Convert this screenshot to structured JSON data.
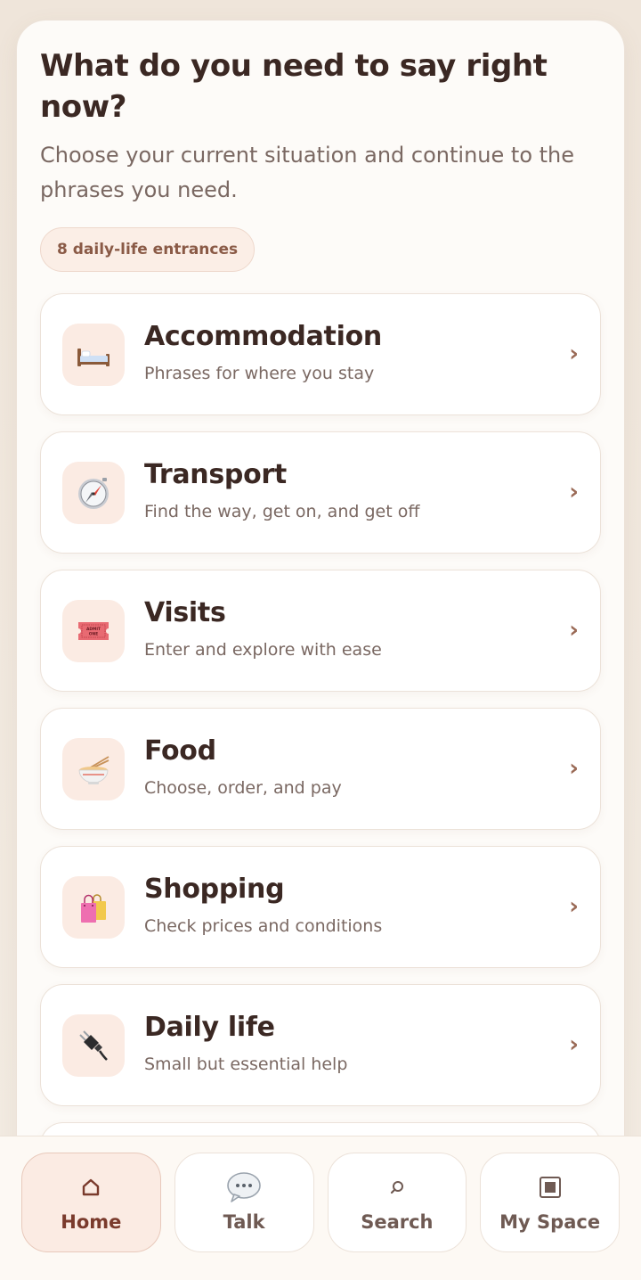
{
  "header": {
    "title": "What do you need to say right now?",
    "subtitle": "Choose your current situation and continue to the phrases you need.",
    "entrances_badge": "8 daily-life entrances"
  },
  "categories": [
    {
      "title": "Accommodation",
      "subtitle": "Phrases for where you stay",
      "icon": "bed-icon"
    },
    {
      "title": "Transport",
      "subtitle": "Find the way, get on, and get off",
      "icon": "compass-icon"
    },
    {
      "title": "Visits",
      "subtitle": "Enter and explore with ease",
      "icon": "ticket-icon",
      "icon_text": "ADMIT ONE"
    },
    {
      "title": "Food",
      "subtitle": "Choose, order, and pay",
      "icon": "noodle-bowl-icon"
    },
    {
      "title": "Shopping",
      "subtitle": "Check prices and conditions",
      "icon": "shopping-bags-icon"
    },
    {
      "title": "Daily life",
      "subtitle": "Small but essential help",
      "icon": "plug-icon"
    }
  ],
  "chevron": "›",
  "bottom_nav": [
    {
      "label": "Home",
      "icon": "home-icon",
      "active": true
    },
    {
      "label": "Talk",
      "icon": "speech-bubble-icon",
      "active": false
    },
    {
      "label": "Search",
      "icon": "search-icon",
      "active": false
    },
    {
      "label": "My Space",
      "icon": "square-icon",
      "active": false
    }
  ],
  "colors": {
    "accent": "#7a3a2c",
    "card_icon_bg": "#fbebe3",
    "text_dark": "#3b2823",
    "text_muted": "#7a6862"
  }
}
